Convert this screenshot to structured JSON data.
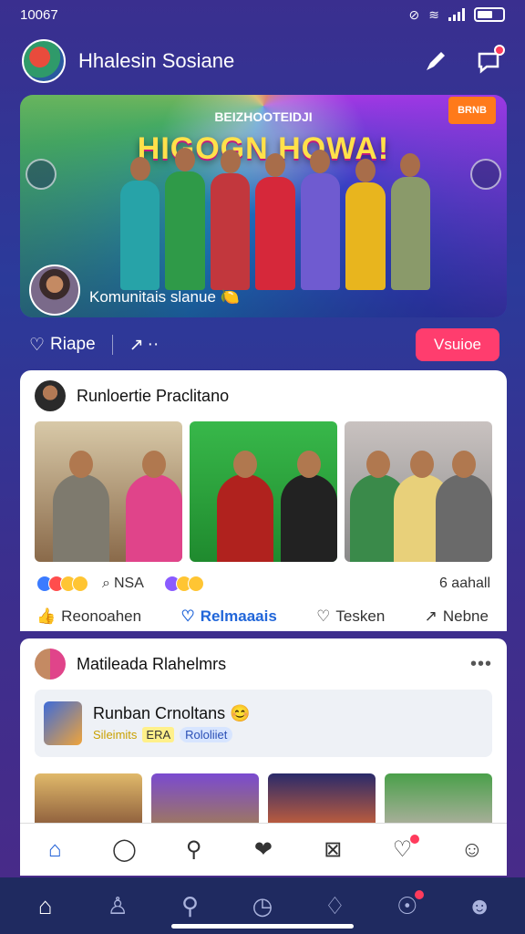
{
  "status_bar": {
    "time": "10067"
  },
  "header": {
    "title": "Hhalesin Sosiane",
    "notification_dot": true
  },
  "hero": {
    "headline": "HIGOGN HOWA!",
    "subheadline": "BEIZHOOTEIDJI",
    "badge": "BRNB",
    "caption": "Komunitais slanue 🍋"
  },
  "action_row": {
    "like_label": "Riape",
    "share_label": "··",
    "cta_label": "Vsuioe"
  },
  "post1": {
    "author": "Runloertie Praclitano",
    "reactions_left": "NSA",
    "reactions_count": "6 aahall",
    "actions": [
      {
        "label": "Reonoahen",
        "icon": "thumbs-up-icon",
        "active": false
      },
      {
        "label": "Relmaaais",
        "icon": "heart-icon",
        "active": true
      },
      {
        "label": "Tesken",
        "icon": "heart-outline-icon",
        "active": false
      },
      {
        "label": "Nebne",
        "icon": "share-arrow-icon",
        "active": false
      }
    ]
  },
  "post2": {
    "author": "Matileada Rlahelmrs",
    "group_title": "Runban Crnoltans 😊",
    "group_tags": [
      "Sileimits",
      "ERA",
      "Rololiiet"
    ]
  },
  "inner_nav": [
    {
      "icon": "home-icon",
      "glyph": "⌂"
    },
    {
      "icon": "chat-bubble-icon",
      "glyph": "◯"
    },
    {
      "icon": "search-icon",
      "glyph": "⚲"
    },
    {
      "icon": "heart-icon",
      "glyph": "❤"
    },
    {
      "icon": "puzzle-icon",
      "glyph": "⊠"
    },
    {
      "icon": "notification-icon",
      "glyph": "♡"
    },
    {
      "icon": "profile-icon",
      "glyph": "☺"
    }
  ],
  "bottom_nav": [
    {
      "icon": "home-icon",
      "glyph": "⌂"
    },
    {
      "icon": "people-icon",
      "glyph": "♙"
    },
    {
      "icon": "search-icon",
      "glyph": "⚲"
    },
    {
      "icon": "clock-icon",
      "glyph": "◷"
    },
    {
      "icon": "bell-icon",
      "glyph": "♢"
    },
    {
      "icon": "alerts-icon",
      "glyph": "☉"
    },
    {
      "icon": "profile-icon",
      "glyph": "☻"
    }
  ],
  "colors": {
    "accent": "#ff3d6e",
    "link": "#2166d9",
    "bg": "#3a2f8f"
  }
}
